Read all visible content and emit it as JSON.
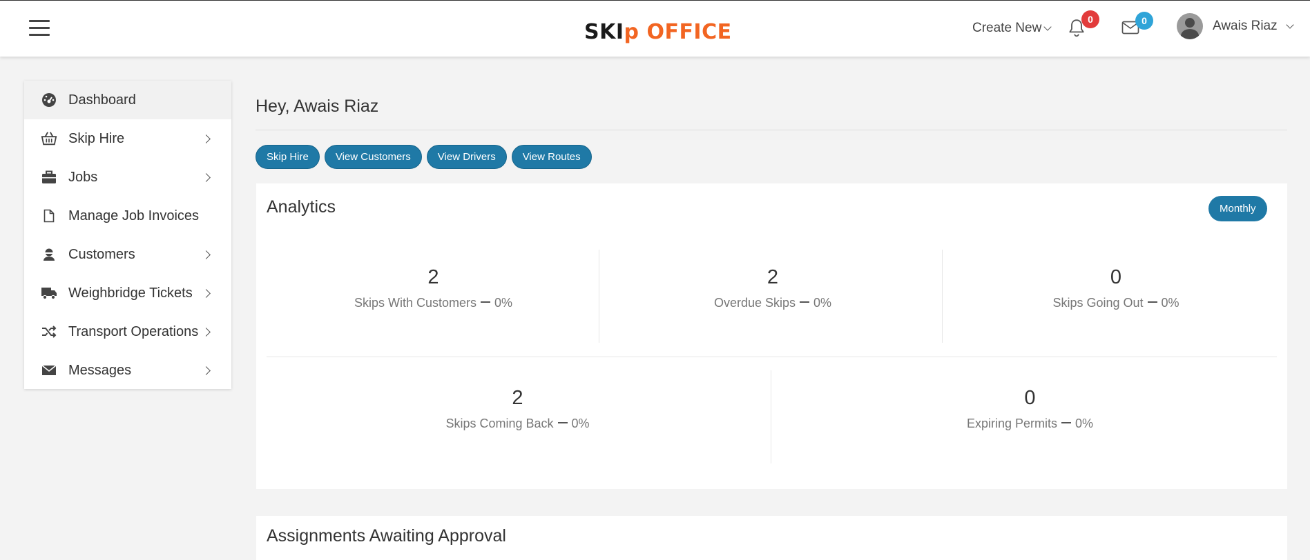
{
  "brand": {
    "logo_part1": "SKI",
    "logo_accent": "p",
    "logo_part2": " OFFICE"
  },
  "header": {
    "create_new": "Create New",
    "notifications_count": "0",
    "messages_count": "0",
    "user_name": "Awais Riaz"
  },
  "sidebar": {
    "items": [
      {
        "label": "Dashboard",
        "icon": "dashboard-icon"
      },
      {
        "label": "Skip Hire",
        "icon": "basket-icon"
      },
      {
        "label": "Jobs",
        "icon": "briefcase-icon"
      },
      {
        "label": "Manage Job Invoices",
        "icon": "file-icon"
      },
      {
        "label": "Customers",
        "icon": "user-icon"
      },
      {
        "label": "Weighbridge Tickets",
        "icon": "truck-icon"
      },
      {
        "label": "Transport Operations",
        "icon": "shuffle-icon"
      },
      {
        "label": "Messages",
        "icon": "envelope-icon"
      }
    ]
  },
  "main": {
    "greeting": "Hey, Awais Riaz",
    "quick_links": [
      "Skip Hire",
      "View Customers",
      "View Drivers",
      "View Routes"
    ],
    "analytics": {
      "title": "Analytics",
      "period": "Monthly",
      "stats": [
        {
          "value": "2",
          "label": "Skips With Customers",
          "percent": "0%"
        },
        {
          "value": "2",
          "label": "Overdue Skips",
          "percent": "0%"
        },
        {
          "value": "0",
          "label": "Skips Going Out",
          "percent": "0%"
        },
        {
          "value": "2",
          "label": "Skips Coming Back",
          "percent": "0%"
        },
        {
          "value": "0",
          "label": "Expiring Permits",
          "percent": "0%"
        }
      ]
    },
    "assignments_title": "Assignments Awaiting Approval"
  },
  "colors": {
    "primary": "#1f79a6",
    "accent": "#f26522",
    "badge_red": "#e23b3b",
    "badge_blue": "#2fa4d8"
  }
}
